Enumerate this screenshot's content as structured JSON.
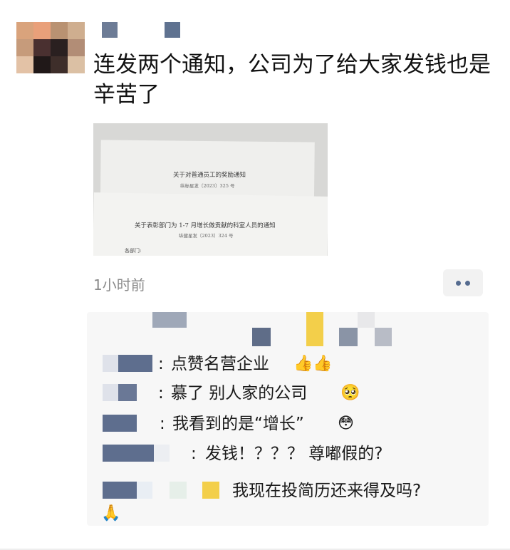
{
  "post": {
    "text": "连发两个通知，公司为了给大家发钱也是辛苦了",
    "time": "1小时前"
  },
  "photo": {
    "doc1_title": "关于对普通员工的奖励通知",
    "doc1_number": "纵标星发〔2023〕325 号",
    "doc2_title": "关于表彰部门为 1-7 月增长做贡献的科室人员的通知",
    "doc2_number": "纵健星发〔2023〕324 号",
    "doc2_salutation": "各部门:"
  },
  "actions": {
    "more_icon": "ellipsis-icon"
  },
  "comments": [
    {
      "sep": ":",
      "text": "点赞名营企业",
      "emoji": "👍👍"
    },
    {
      "sep": ":",
      "text": "慕了 别人家的公司",
      "emoji": "🥺"
    },
    {
      "sep": ":",
      "text": "我看到的是“增长”",
      "emoji": "😳"
    },
    {
      "sep": ":",
      "text": "发钱！？？？ 尊嘟假的?",
      "emoji": ""
    },
    {
      "sep": "",
      "text": "我现在投简历还来得及吗?",
      "emoji": "🙏"
    }
  ],
  "colors": {
    "link_blue": "#556b8f",
    "comment_bg": "#f7f7f7",
    "time_gray": "#8a8a8a"
  }
}
